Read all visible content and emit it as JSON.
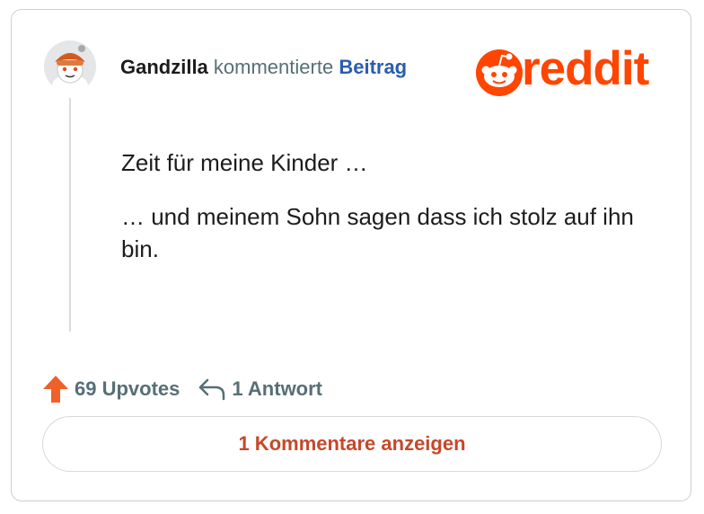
{
  "header": {
    "username": "Gandzilla",
    "verb": "kommentierte",
    "post_link": "Beitrag"
  },
  "brand": {
    "logo_text": "reddit",
    "color": "#ff4500"
  },
  "comment": {
    "paragraphs": [
      "Zeit für meine Kinder …",
      "… und meinem Sohn sagen dass ich stolz auf ihn bin."
    ]
  },
  "actions": {
    "upvote_icon": "upvote-arrow-icon",
    "upvotes_label": "69 Upvotes",
    "reply_icon": "reply-arrow-icon",
    "replies_label": "1 Antwort"
  },
  "footer": {
    "view_comments_label": "1 Kommentare anzeigen",
    "accent": "#c5482a"
  }
}
